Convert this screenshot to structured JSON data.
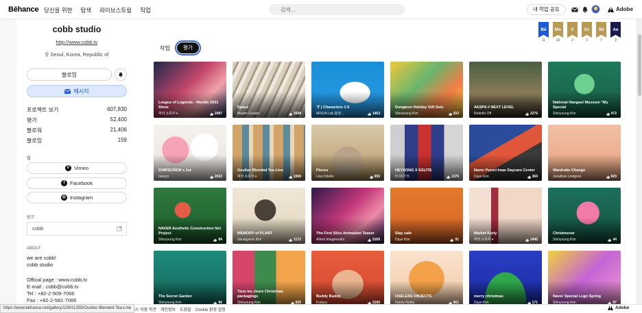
{
  "topbar": {
    "logo": "Bēhance",
    "nav": [
      "당신을 위한",
      "탐색",
      "라이브스트림",
      "직업"
    ],
    "search_placeholder": "검색...",
    "share_label": "내 작업 공유",
    "adobe_label": "Adobe"
  },
  "profile": {
    "name": "cobb studio",
    "url": "http://www.cobb.tv",
    "location": "Seoul, Korea, Republic of",
    "follow_label": "팔로잉",
    "message_label": "메시지",
    "stats": [
      {
        "label": "프로젝트 보기",
        "value": "607,830"
      },
      {
        "label": "평가",
        "value": "52,400"
      },
      {
        "label": "팔로워",
        "value": "21,406"
      },
      {
        "label": "팔로잉",
        "value": "159"
      }
    ],
    "web_label": "웹",
    "socials": [
      {
        "label": "Vimeo",
        "glyph": "V"
      },
      {
        "label": "Facebook",
        "glyph": "f"
      },
      {
        "label": "Instagram",
        "glyph": "◎"
      }
    ],
    "link_label": "링크",
    "link_value": "cobb",
    "about_label": "ABOUT",
    "about_lines": [
      "we are cobb!",
      "cobb studio"
    ],
    "contact_lines": [
      "Offical page : www.cobb.tv",
      "E-mail : cobb@cobb.tv",
      "Tel : +82-2-509-7066",
      "Fax : +82-2-581-7066"
    ]
  },
  "tabs": {
    "work": "작업",
    "liked": "평가"
  },
  "badges": [
    {
      "code": "Bē",
      "count": "11",
      "color": "#1d5bd6"
    },
    {
      "code": "Mo",
      "count": "19",
      "color": "#b89a55"
    },
    {
      "code": "Il",
      "count": "2",
      "color": "#b89a55"
    },
    {
      "code": "Gr",
      "count": "3",
      "color": "#b89a55"
    },
    {
      "code": "3D",
      "count": "7",
      "color": "#b89a55"
    },
    {
      "code": "Ae",
      "count": "9",
      "color": "#1a1a4d"
    }
  ],
  "projects": [
    {
      "title": "League of Legends - Worlds 2021 Show",
      "owner": "여러 소유자 ▾",
      "likes": "2087",
      "bg": "linear-gradient(135deg,#1c2a4a 0%,#c2456b 45%,#f0a1a8 70%,#2b3f6c 100%)"
    },
    {
      "title": "Space",
      "owner": "Maxim Goudin",
      "likes": "2648",
      "bg": "repeating-linear-gradient(115deg,#d9cfbf 0 6px,#a79b86 6px 9px,#efe8dc 9px 14px)"
    },
    {
      "title": "マ | Characters 1-5",
      "owner": "MISUA Lab 봄생...",
      "likes": "1463",
      "bg": "radial-gradient(ellipse at 60% 55%,#fff 0 24%,transparent 25%),linear-gradient(#1a8fd8,#2b9be6)"
    },
    {
      "title": "Dongwon Holiday Gift Sets",
      "owner": "Shinyoung Kim",
      "likes": "203",
      "bg": "linear-gradient(135deg,#f3c93a 0%,#68b66d 40%,#f17d47 70%,#f3c93a 100%)"
    },
    {
      "title": "AESPA // NEXT LEVEL",
      "owner": "Rodolfo Off",
      "likes": "2276",
      "bg": "linear-gradient(#4a5e43,#8b7d5a 60%,#3b3125)"
    },
    {
      "title": "National Hangeul Museum \"My Special",
      "owner": "Shinyoung Kim",
      "likes": "472",
      "bg": "radial-gradient(circle at 50% 40%,#6ed191 0 20%,transparent 21%),linear-gradient(#1f7a5a,#175a44)"
    },
    {
      "title": "CHIPSCREW x 1st",
      "owner": "meeyo",
      "likes": "2022",
      "bg": "radial-gradient(circle at 30% 45%,#f5a3b5 0 22%,transparent 23%),radial-gradient(circle at 70% 40%,#fff 0 22%,transparent 23%),linear-gradient(#f5f1ec,#e9e4df)"
    },
    {
      "title": "Osulloc Blended Tea Line",
      "owner": "여러 소유자 ▾",
      "likes": "1596",
      "bg": "repeating-linear-gradient(90deg,#d2a46a 0 14px,#5a8c9c 14px 24px,#e8d6b9 24px 30px)"
    },
    {
      "title": "Pieces",
      "owner": "Lisa Odette",
      "likes": "655",
      "bg": "radial-gradient(ellipse at 50% 65%,#b9a48a 0 28%,transparent 29%),linear-gradient(#d8c9a9,#b89a68)"
    },
    {
      "title": "HEYSONG X ESLITE",
      "owner": "H OUT H",
      "likes": "1370",
      "bg": "linear-gradient(90deg,#cfcfcf 0 20%,#2f3d8a 20% 38%,#c9322f 38% 56%,#2f3d8a 56% 74%,#d5d5d5 74%)"
    },
    {
      "title": "Naver Pururi Imae Daycare Center",
      "owner": "Daye Kim",
      "likes": "369",
      "bg": "linear-gradient(150deg,#2a4c9b 0 40%,#e0563a 40% 60%,#3a3a3a 60%)"
    },
    {
      "title": "Wardrobe Change",
      "owner": "Jonathan Lindgren",
      "likes": "820",
      "bg": "linear-gradient(#f2c1a5,#e6a17e)"
    },
    {
      "title": "NAVER Aesthetic Construction Net Project",
      "owner": "Shinyoung Kim",
      "likes": "84",
      "bg": "radial-gradient(circle at 40% 40%,#e35c46 0 14%,transparent 15%),linear-gradient(#2f7a3e,#1c5a2b)"
    },
    {
      "title": "MEMORY of PLANT",
      "owner": "Seungyeon Kim",
      "likes": "1172",
      "bg": "radial-gradient(circle at 45% 40%,#4a4138 0 20%,transparent 21%),linear-gradient(#efe6d5,#e3d6bf)"
    },
    {
      "title": "The First Slice Animation Teaser",
      "owner": "Alfred Imageworks",
      "likes": "3169",
      "bg": "linear-gradient(135deg,#2c1a4a 0%,#c1377a 45%,#ef8aa8 70%,#38205a 100%)"
    },
    {
      "title": "Stay safe",
      "owner": "Daye Kim",
      "likes": "91",
      "bg": "linear-gradient(#e37a2c,#d96427)"
    },
    {
      "title": "Market Kurly",
      "owner": "여러 소유자 ▾",
      "likes": "1445",
      "bg": "linear-gradient(90deg,#f3ded2 0 30%,#a02c3f 30% 40%,#f0d7c6 40%)"
    },
    {
      "title": "Christmeow",
      "owner": "Shinyoung Kim",
      "likes": "44",
      "bg": "radial-gradient(circle at 55% 45%,#f17aa8 0 22%,transparent 23%),linear-gradient(#1c6f5d,#14523f)"
    },
    {
      "title": "The Secret Garden",
      "owner": "Shinyoung Kim",
      "likes": "66",
      "bg": "linear-gradient(#1e8a7a,#14675b)"
    },
    {
      "title": "Tous les Jours Christmas packagings",
      "owner": "Shinyoung Kim",
      "likes": "835",
      "bg": "linear-gradient(90deg,#d6456a 0 30%,#3f8b4e 30% 60%,#f2a54a 60%)"
    },
    {
      "title": "Buddy Buddy",
      "owner": "Fudura",
      "likes": "3190",
      "bg": "radial-gradient(ellipse at 50% 60%,#e9b48f 0 30%,transparent 31%),linear-gradient(#e65d3c,#d54730)"
    },
    {
      "title": "USELESS OBJECTS",
      "owner": "Fanny Rollot",
      "likes": "661",
      "bg": "radial-gradient(circle at 50% 50%,#f4a24a 0 38%,transparent 39%),linear-gradient(#fbe3cf,#f2c9a6)"
    },
    {
      "title": "merry christmas",
      "owner": "Daye Kim",
      "likes": "171",
      "bg": "radial-gradient(ellipse at 50% 90%,#2fa84e 0 40%,transparent 41%),linear-gradient(#2a3ec4,#1a2aa0)"
    },
    {
      "title": "Naver Special Logo Spring",
      "owner": "Shinyoung Kim",
      "likes": "87",
      "bg": "linear-gradient(135deg,#f0d13b 0%,#c564d6 50%,#f29bd1 100%)"
    }
  ],
  "footer": {
    "status_url": "https://www.behance.net/gallery/116011355/Osulloc-Blended-Tea-Line",
    "links": [
      "서비스 이용 약관",
      "개인정보",
      "도움말",
      "Cookie 환경 설정"
    ],
    "adobe_label": "Adobe"
  }
}
